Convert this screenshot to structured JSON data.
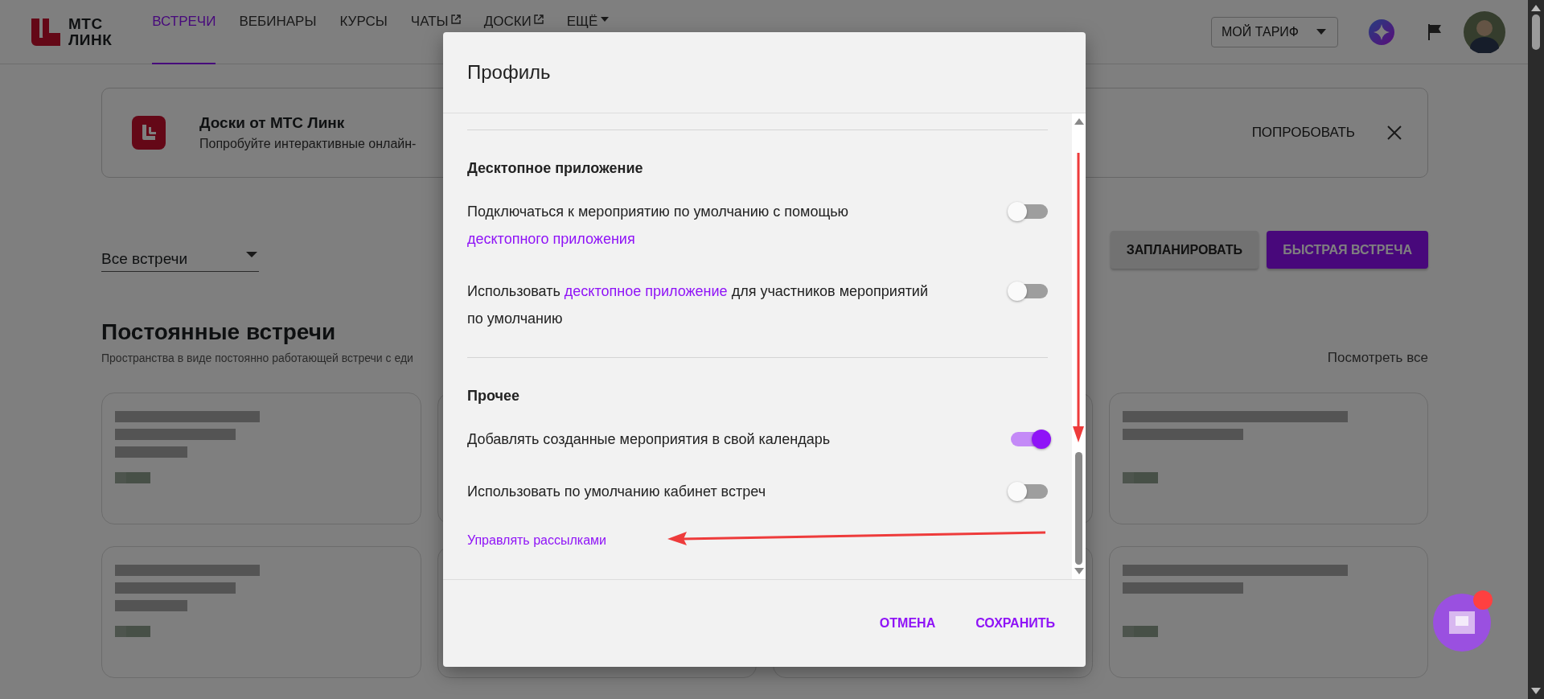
{
  "header": {
    "logo": {
      "lines": [
        "МТС",
        "ЛИНК"
      ]
    },
    "nav": [
      {
        "label": "ВСТРЕЧИ",
        "selected": true,
        "kind": "plain"
      },
      {
        "label": "ВЕБИНАРЫ",
        "selected": false,
        "kind": "plain"
      },
      {
        "label": "КУРСЫ",
        "selected": false,
        "kind": "plain"
      },
      {
        "label": "ЧАТЫ",
        "selected": false,
        "kind": "external"
      },
      {
        "label": "ДОСКИ",
        "selected": false,
        "kind": "external"
      },
      {
        "label": "ЕЩЁ",
        "selected": false,
        "kind": "menu"
      }
    ],
    "tariff": {
      "label": "МОЙ ТАРИФ"
    }
  },
  "banner": {
    "title": "Доски от МТС Линк",
    "text": "Попробуйте интерактивные онлайн-",
    "action": "ПОПРОБОВАТЬ"
  },
  "filter": {
    "value": "Все встречи"
  },
  "actions": [
    {
      "label": "ЗАПЛАНИРОВАТЬ",
      "kind": "secondary"
    },
    {
      "label": "БЫСТРАЯ ВСТРЕЧА",
      "kind": "primary"
    }
  ],
  "section": {
    "title": "Постоянные встречи",
    "subtitle": "Пространства в виде постоянно работающей встречи с еди",
    "view_all": "Посмотреть все"
  },
  "cards": [
    {
      "kind": "blurred"
    },
    {
      "kind": "covered"
    },
    {
      "kind": "covered"
    },
    {
      "kind": "blurred"
    },
    {
      "kind": "blurred"
    },
    {
      "kind": "covered"
    },
    {
      "kind": "covered"
    },
    {
      "kind": "blurred"
    }
  ],
  "modal": {
    "title": "Профиль",
    "sections": [
      {
        "title": "Десктопное приложение",
        "settings": [
          {
            "parts": [
              {
                "text": "Подключаться к мероприятию по умолчанию с помощью",
                "link": false
              },
              {
                "text": "десктопного приложения",
                "link": true
              }
            ],
            "on": false
          },
          {
            "parts": [
              {
                "text": "Использовать",
                "link": false
              },
              {
                "text": "десктопное приложение",
                "link": true
              },
              {
                "text": "для участников мероприятий по умолчанию",
                "link": false
              }
            ],
            "on": false
          }
        ]
      },
      {
        "title": "Прочее",
        "settings": [
          {
            "parts": [
              {
                "text": "Добавлять созданные мероприятия в свой календарь",
                "link": false
              }
            ],
            "on": true
          },
          {
            "parts": [
              {
                "text": "Использовать по умолчанию кабинет встреч",
                "link": false
              }
            ],
            "on": false
          }
        ],
        "link": "Управлять рассылками"
      }
    ],
    "buttons": [
      {
        "label": "ОТМЕНА"
      },
      {
        "label": "СОХРАНИТЬ"
      }
    ]
  },
  "annotations": [
    {
      "kind": "arrow_down"
    },
    {
      "kind": "arrow_left"
    }
  ]
}
